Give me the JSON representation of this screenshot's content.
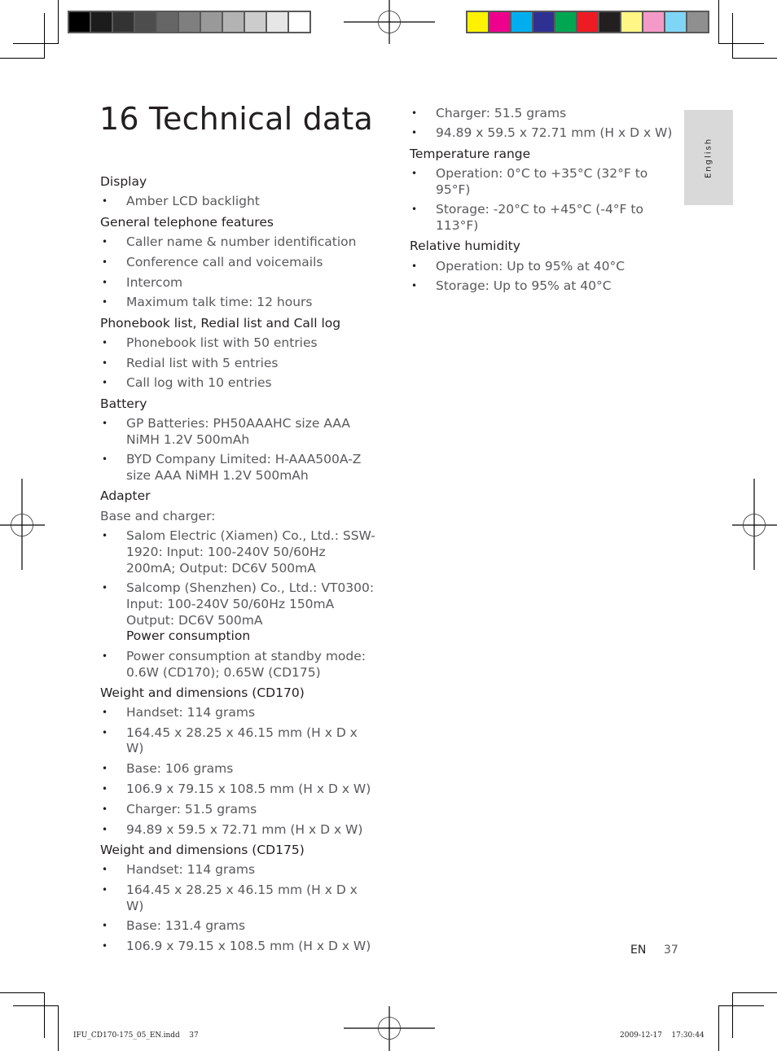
{
  "print_marks": {
    "grayscale_swatches": [
      "#000000",
      "#1c1c1c",
      "#333333",
      "#4d4d4d",
      "#666666",
      "#7f7f7f",
      "#999999",
      "#b3b3b3",
      "#cccccc",
      "#e6e6e6",
      "#ffffff"
    ],
    "color_swatches": [
      "#fff200",
      "#ec008c",
      "#00aeef",
      "#2e3192",
      "#00a651",
      "#ed1c24",
      "#231f20",
      "#fff685",
      "#f49ac9",
      "#7fd5f6",
      "#8f8f8f"
    ]
  },
  "page": {
    "title": "16 Technical data",
    "language_tab": "English",
    "footer_lang": "EN",
    "page_number": "37"
  },
  "left_column": {
    "display": {
      "heading": "Display",
      "items": [
        "Amber LCD backlight"
      ]
    },
    "general": {
      "heading": "General telephone features",
      "items": [
        "Caller name & number identification",
        "Conference call and voicemails",
        "Intercom",
        "Maximum talk time: 12 hours"
      ]
    },
    "phonebook": {
      "heading": "Phonebook list, Redial list and Call log",
      "items": [
        "Phonebook list with 50 entries",
        "Redial list with 5 entries",
        "Call log with 10 entries"
      ]
    },
    "battery": {
      "heading": "Battery",
      "items": [
        "GP Batteries: PH50AAAHC size AAA NiMH 1.2V 500mAh",
        "BYD Company Limited: H-AAA500A-Z size AAA NiMH 1.2V 500mAh"
      ]
    },
    "adapter": {
      "heading": "Adapter",
      "intro": "Base and charger:",
      "items": [
        "Salom Electric (Xiamen) Co., Ltd.: SSW-1920: Input: 100-240V 50/60Hz 200mA; Output: DC6V 500mA",
        "Salcomp (Shenzhen) Co., Ltd.: VT0300: Input: 100-240V 50/60Hz 150mA Output: DC6V 500mA"
      ],
      "sub_heading": "Power consumption"
    },
    "power": {
      "items": [
        "Power consumption at standby mode: 0.6W (CD170); 0.65W (CD175)"
      ]
    },
    "cd170": {
      "heading": "Weight and dimensions (CD170)",
      "items": [
        "Handset: 114 grams",
        "164.45 x 28.25 x 46.15 mm (H x D x W)",
        "Base: 106 grams",
        "106.9 x 79.15 x 108.5 mm (H x D x W)",
        "Charger: 51.5 grams",
        "94.89 x 59.5 x 72.71 mm (H x D x W)"
      ]
    },
    "cd175": {
      "heading": "Weight and dimensions (CD175)",
      "items": [
        "Handset: 114 grams",
        "164.45 x 28.25 x 46.15 mm (H x D x W)",
        "Base: 131.4 grams",
        "106.9 x 79.15 x 108.5 mm (H x D x W)"
      ]
    }
  },
  "right_column": {
    "cd175_cont": {
      "items": [
        "Charger: 51.5 grams",
        "94.89 x 59.5 x 72.71 mm (H x D x W)"
      ]
    },
    "temperature": {
      "heading": "Temperature range",
      "items": [
        "Operation: 0°C to +35°C (32°F to 95°F)",
        "Storage: -20°C to +45°C (-4°F to 113°F)"
      ]
    },
    "humidity": {
      "heading": "Relative humidity",
      "items": [
        "Operation: Up to 95% at 40°C",
        "Storage: Up to 95% at 40°C"
      ]
    }
  },
  "slug": {
    "file": "IFU_CD170-175_05_EN.indd",
    "page": "37",
    "date": "2009-12-17",
    "time": "17:30:44"
  },
  "bullet_glyph": "•"
}
